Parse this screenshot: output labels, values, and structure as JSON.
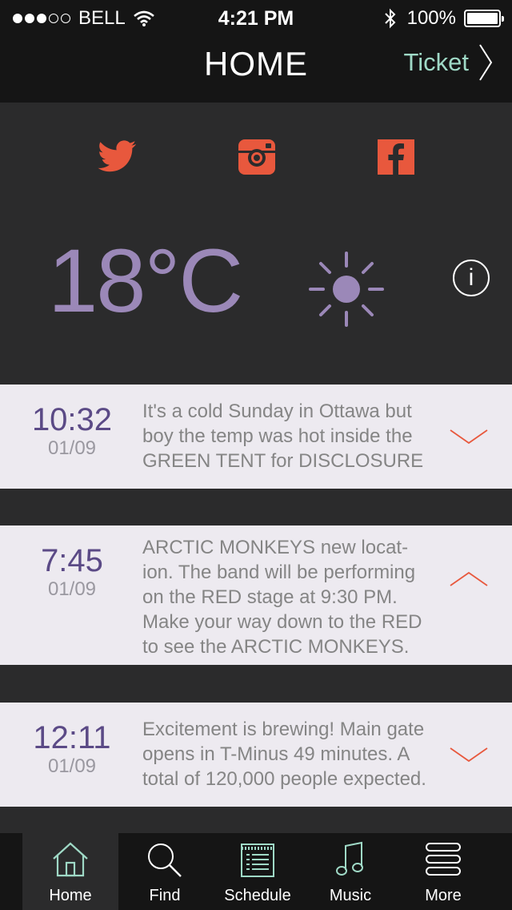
{
  "status_bar": {
    "carrier": "BELL",
    "time": "4:21 PM",
    "battery": "100%"
  },
  "nav": {
    "title": "HOME",
    "ticket_label": "Ticket"
  },
  "social": [
    "twitter-icon",
    "instagram-icon",
    "facebook-icon"
  ],
  "weather": {
    "temperature": "18°C",
    "condition_icon": "sun-icon",
    "info_label": "i"
  },
  "feed": [
    {
      "time": "10:32",
      "date": "01/09",
      "lines": [
        "It's a cold Sunday in Ottawa but",
        "boy the temp was hot inside the",
        "GREEN TENT for DISCLOSURE"
      ],
      "expanded": false
    },
    {
      "time": "7:45",
      "date": "01/09",
      "lines": [
        "ARCTIC MONKEYS new locat-",
        "ion. The band will be performing",
        "on the RED stage at 9:30 PM.",
        "Make your way down to the RED",
        "to see the ARCTIC MONKEYS."
      ],
      "expanded": true
    },
    {
      "time": "12:11",
      "date": "01/09",
      "lines": [
        "Excitement is brewing! Main gate",
        "opens in T-Minus 49 minutes. A",
        "total of 120,000 people expected."
      ],
      "expanded": false
    }
  ],
  "tabs": [
    {
      "label": "Home",
      "icon": "home-icon",
      "active": true
    },
    {
      "label": "Find",
      "icon": "search-icon",
      "active": false
    },
    {
      "label": "Schedule",
      "icon": "schedule-icon",
      "active": false
    },
    {
      "label": "Music",
      "icon": "music-note-icon",
      "active": false
    },
    {
      "label": "More",
      "icon": "more-icon",
      "active": false
    }
  ],
  "colors": {
    "accent_purple": "#9b88b8",
    "accent_teal": "#9fd9c6",
    "social_orange": "#e8583d",
    "background": "#2b2b2c",
    "card": "#edeaf0"
  }
}
